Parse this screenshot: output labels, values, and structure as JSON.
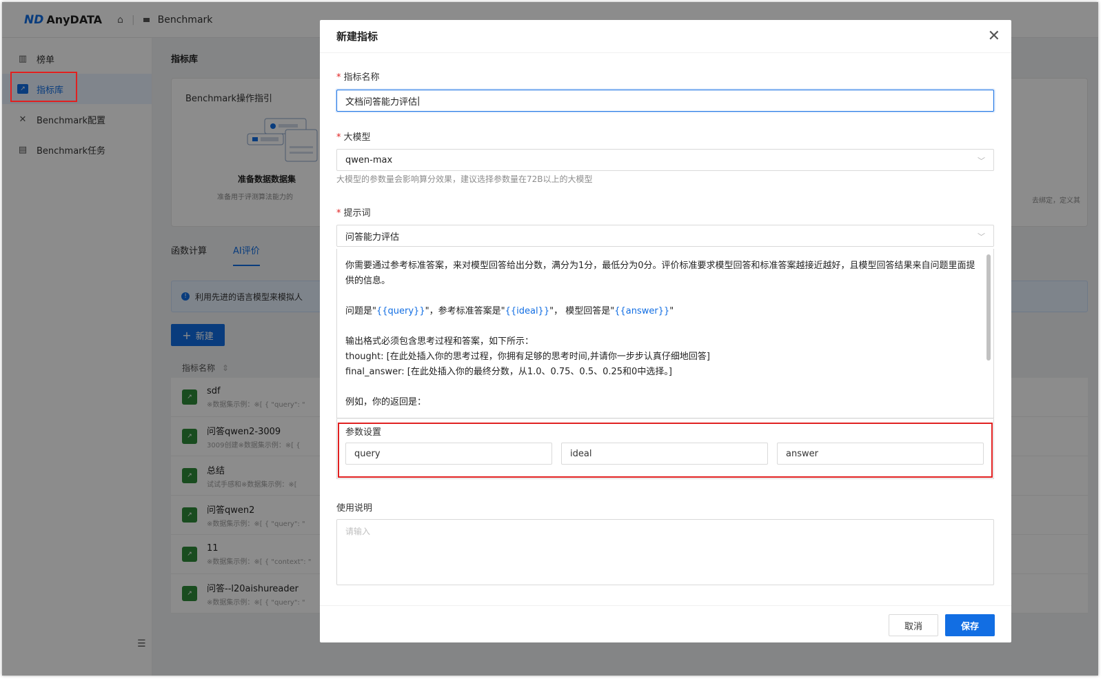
{
  "topbar": {
    "logo_mark": "ND",
    "logo_text": "AnyDATA",
    "breadcrumb": "Benchmark"
  },
  "sidebar": {
    "items": [
      {
        "label": "榜单",
        "icon": "bar-chart-icon"
      },
      {
        "label": "指标库",
        "icon": "metric-library-icon",
        "active": true
      },
      {
        "label": "Benchmark配置",
        "icon": "tools-icon"
      },
      {
        "label": "Benchmark任务",
        "icon": "task-icon"
      }
    ]
  },
  "main": {
    "title": "指标库",
    "guide": {
      "title": "Benchmark操作指引",
      "step_title": "准备数据数据集",
      "step_desc": "准备用于评测算法能力的",
      "right_text": "去绑定，定义其"
    },
    "tabs": [
      {
        "label": "函数计算"
      },
      {
        "label": "AI评价",
        "active": true
      }
    ],
    "info": "利用先进的语言模型来模拟人",
    "new_button": "新建",
    "column_header": "指标名称",
    "rows": [
      {
        "name": "sdf",
        "sub": "※数据集示例：※[ { \"query\": \""
      },
      {
        "name": "问答qwen2-3009",
        "sub": "3009创建※数据集示例：※[ {"
      },
      {
        "name": "总结",
        "sub": "试试手感和※数据集示例：※["
      },
      {
        "name": "问答qwen2",
        "sub": "※数据集示例：※[ { \"query\": \""
      },
      {
        "name": "11",
        "sub": "※数据集示例：※[ { \"context\": \""
      },
      {
        "name": "问答--l20aishureader",
        "sub": "※数据集示例：※[ { \"query\": \""
      }
    ]
  },
  "modal": {
    "title": "新建指标",
    "name_label": "指标名称",
    "name_value": "文档问答能力评估",
    "model_label": "大模型",
    "model_value": "qwen-max",
    "model_hint": "大模型的参数量会影响算分效果，建议选择参数量在72B以上的大模型",
    "prompt_label": "提示词",
    "prompt_value": "问答能力评估",
    "prompt_body": {
      "p1": "你需要通过参考标准答案，来对模型回答给出分数，满分为1分，最低分为0分。评价标准要求模型回答和标准答案越接近越好，且模型回答结果来自问题里面提供的信息。",
      "p2_a": "问题是\"",
      "p2_q": "{{query}}",
      "p2_b": "\"，参考标准答案是\"",
      "p2_i": "{{ideal}}",
      "p2_c": "\"， 模型回答是\"",
      "p2_ans": "{{answer}}",
      "p2_d": "\"",
      "p3_l1": "输出格式必须包含思考过程和答案，如下所示：",
      "p3_l2": "thought: [在此处插入你的思考过程，你拥有足够的思考时间,并请你一步步认真仔细地回答]",
      "p3_l3": "final_answer: [在此处插入你的最终分数，从1.0、0.75、0.5、0.25和0中选择。]",
      "p4": "例如，你的返回是："
    },
    "params_label": "参数设置",
    "params": [
      "query",
      "ideal",
      "answer"
    ],
    "usage_label": "使用说明",
    "usage_placeholder": "请输入",
    "cancel": "取消",
    "save": "保存"
  },
  "colors": {
    "primary": "#126ee3",
    "highlight_box": "#e02020",
    "required": "#e02020"
  }
}
